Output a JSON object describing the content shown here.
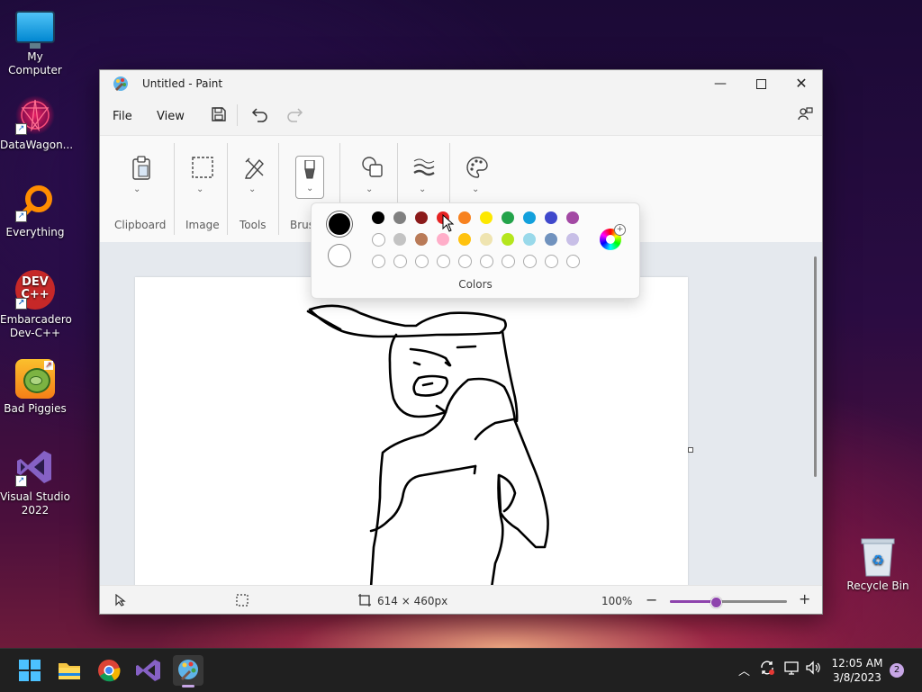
{
  "desktop": {
    "icons": [
      {
        "label": "My Computer"
      },
      {
        "label": "DataWagon..."
      },
      {
        "label": "Everything"
      },
      {
        "label": "Embarcadero Dev-C++"
      },
      {
        "label": "Bad Piggies"
      },
      {
        "label": "Visual Studio 2022"
      },
      {
        "label": "Recycle Bin"
      }
    ]
  },
  "window": {
    "title": "Untitled - Paint",
    "menu": {
      "file": "File",
      "view": "View"
    },
    "ribbon": {
      "clipboard": "Clipboard",
      "image": "Image",
      "tools": "Tools",
      "brushes": "Brus"
    },
    "colors_popup": {
      "label": "Colors",
      "primary": "#000000",
      "secondary": "#ffffff",
      "row1": [
        "#000000",
        "#808080",
        "#8b1a1a",
        "#e52222",
        "#f7821f",
        "#fde800",
        "#23a34a",
        "#12a0dc",
        "#3f48cc",
        "#a349a4"
      ],
      "row2": [
        "#ffffff",
        "#c3c3c3",
        "#b97a57",
        "#ffaec9",
        "#ffc20e",
        "#efe4b0",
        "#b5e61d",
        "#99d9ea",
        "#7092be",
        "#c8bfe7"
      ],
      "row3_count": 10
    },
    "status": {
      "canvas_size": "614 × 460px",
      "zoom": "100%",
      "zoom_fraction": 0.39
    }
  },
  "taskbar": {
    "time": "12:05 AM",
    "date": "3/8/2023",
    "notification_count": "2"
  }
}
